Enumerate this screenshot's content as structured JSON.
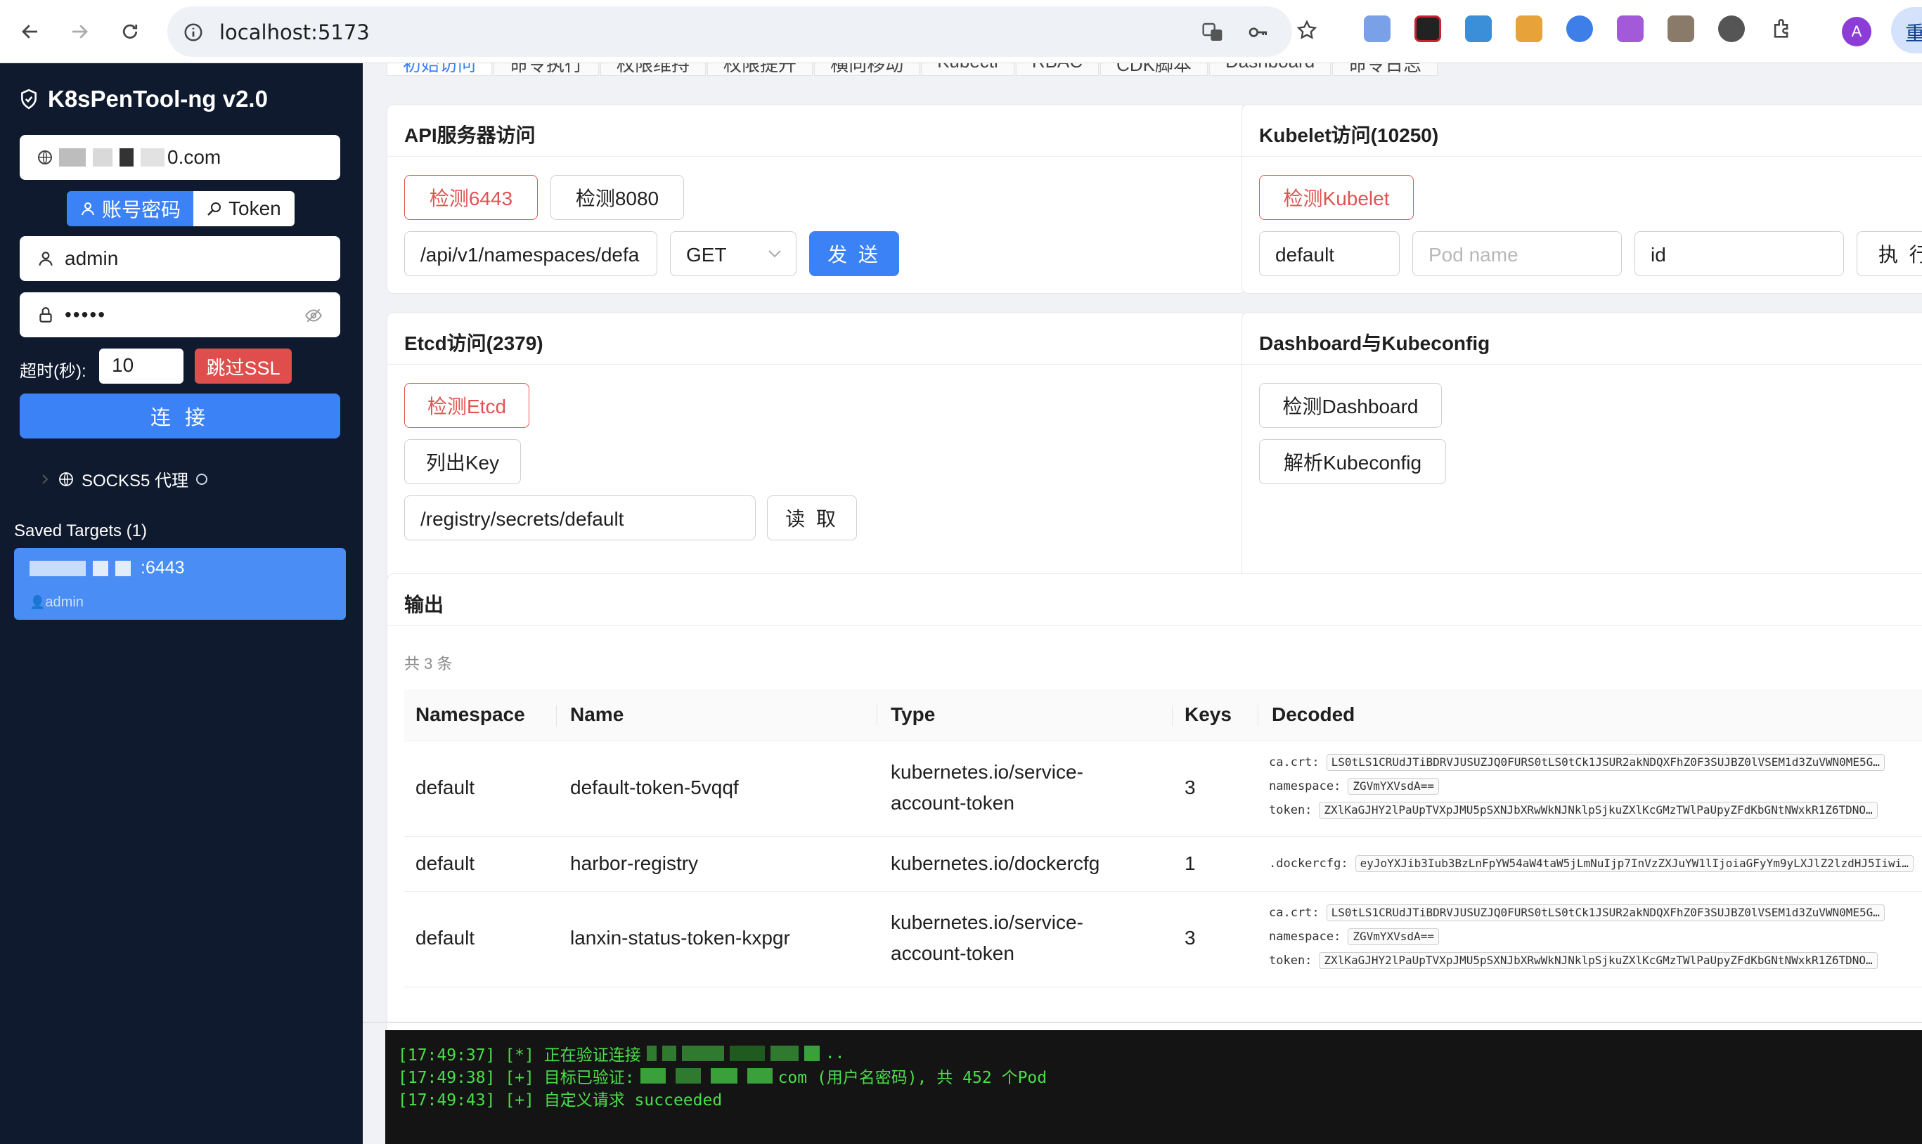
{
  "browser": {
    "url": "localhost:5173",
    "profile_initial": "A",
    "side_label": "重"
  },
  "sidebar": {
    "app_title": "K8sPenTool-ng v2.0",
    "server_suffix": "0.com",
    "auth_tabs": {
      "password": "账号密码",
      "token": "Token"
    },
    "username": "admin",
    "password_mask": "•••••",
    "timeout_label": "超时(秒):",
    "timeout_value": "10",
    "ssl_button": "跳过SSL",
    "connect_button": "连 接",
    "socks_label": "SOCKS5 代理",
    "saved_targets_label": "Saved Targets (1)",
    "saved_targets": [
      {
        "port": ":6443",
        "user": "admin"
      }
    ]
  },
  "tabs": [
    "初始访问",
    "命令执行",
    "权限维持",
    "权限提升",
    "横向移动",
    "Kubectl",
    "RBAC",
    "CDK脚本",
    "Dashboard",
    "命令日志"
  ],
  "api_card": {
    "title": "API服务器访问",
    "btn_6443": "检测6443",
    "btn_8080": "检测8080",
    "path": "/api/v1/namespaces/defa",
    "method": "GET",
    "send": "发 送"
  },
  "kubelet_card": {
    "title": "Kubelet访问(10250)",
    "btn_check": "检测Kubelet",
    "namespace": "default",
    "pod_placeholder": "Pod name",
    "command": "id",
    "exec": "执 行"
  },
  "etcd_card": {
    "title": "Etcd访问(2379)",
    "btn_check": "检测Etcd",
    "btn_list": "列出Key",
    "key_path": "/registry/secrets/default",
    "read": "读 取"
  },
  "dash_card": {
    "title": "Dashboard与Kubeconfig",
    "btn_dash": "检测Dashboard",
    "btn_kubeconfig": "解析Kubeconfig"
  },
  "output": {
    "title": "输出",
    "count": "共 3 条",
    "columns": [
      "Namespace",
      "Name",
      "Type",
      "Keys",
      "Decoded"
    ],
    "rows": [
      {
        "namespace": "default",
        "name": "default-token-5vqqf",
        "type_l1": "kubernetes.io/service-",
        "type_l2": "account-token",
        "keys": "3",
        "decoded": [
          {
            "k": "ca.crt:",
            "v": "LS0tLS1CRUdJTiBDRVJUSUZJQ0FURS0tLS0tCk1JSUR2akNDQXFhZ0F3SUJBZ0lVSEM1d3ZuVWN0ME5G…"
          },
          {
            "k": "namespace:",
            "v": "ZGVmYXVsdA=="
          },
          {
            "k": "token:",
            "v": "ZXlKaGJHY2lPaUpTVXpJMU5pSXNJbXRwWkNJNklpSjkuZXlKcGMzTWlPaUpyZFdKbGNtNWxkR1Z6TDNO…"
          }
        ]
      },
      {
        "namespace": "default",
        "name": "harbor-registry",
        "type_l1": "kubernetes.io/dockercfg",
        "type_l2": "",
        "keys": "1",
        "decoded": [
          {
            "k": ".dockercfg:",
            "v": "eyJoYXJib3Iub3BzLnFpYW54aW4taW5jLmNuIjp7InVzZXJuYW1lIjoiaGFyYm9yLXJlZ2lzdHJ5Iiwi…"
          }
        ]
      },
      {
        "namespace": "default",
        "name": "lanxin-status-token-kxpgr",
        "type_l1": "kubernetes.io/service-",
        "type_l2": "account-token",
        "keys": "3",
        "decoded": [
          {
            "k": "ca.crt:",
            "v": "LS0tLS1CRUdJTiBDRVJUSUZJQ0FURS0tLS0tCk1JSUR2akNDQXFhZ0F3SUJBZ0lVSEM1d3ZuVWN0ME5G…"
          },
          {
            "k": "namespace:",
            "v": "ZGVmYXVsdA=="
          },
          {
            "k": "token:",
            "v": "ZXlKaGJHY2lPaUpTVXpJMU5pSXNJbXRwWkNJNklpSjkuZXlKcGMzTWlPaUpyZFdKbGNtNWxkR1Z6TDNO…"
          }
        ]
      }
    ]
  },
  "log": {
    "line1_prefix": "[17:49:37] [*] 正在验证连接",
    "line1_suffix": "..",
    "line2_prefix": "[17:49:38] [+] 目标已验证:",
    "line2_suffix": "com (用户名密码), 共 452 个Pod",
    "line3": "[17:49:43] [+] 自定义请求 succeeded"
  },
  "colors": {
    "accent": "#3b82f6",
    "danger": "#e05353",
    "sidebar": "#0f1a2e",
    "terminal_text": "#4ade4a"
  }
}
